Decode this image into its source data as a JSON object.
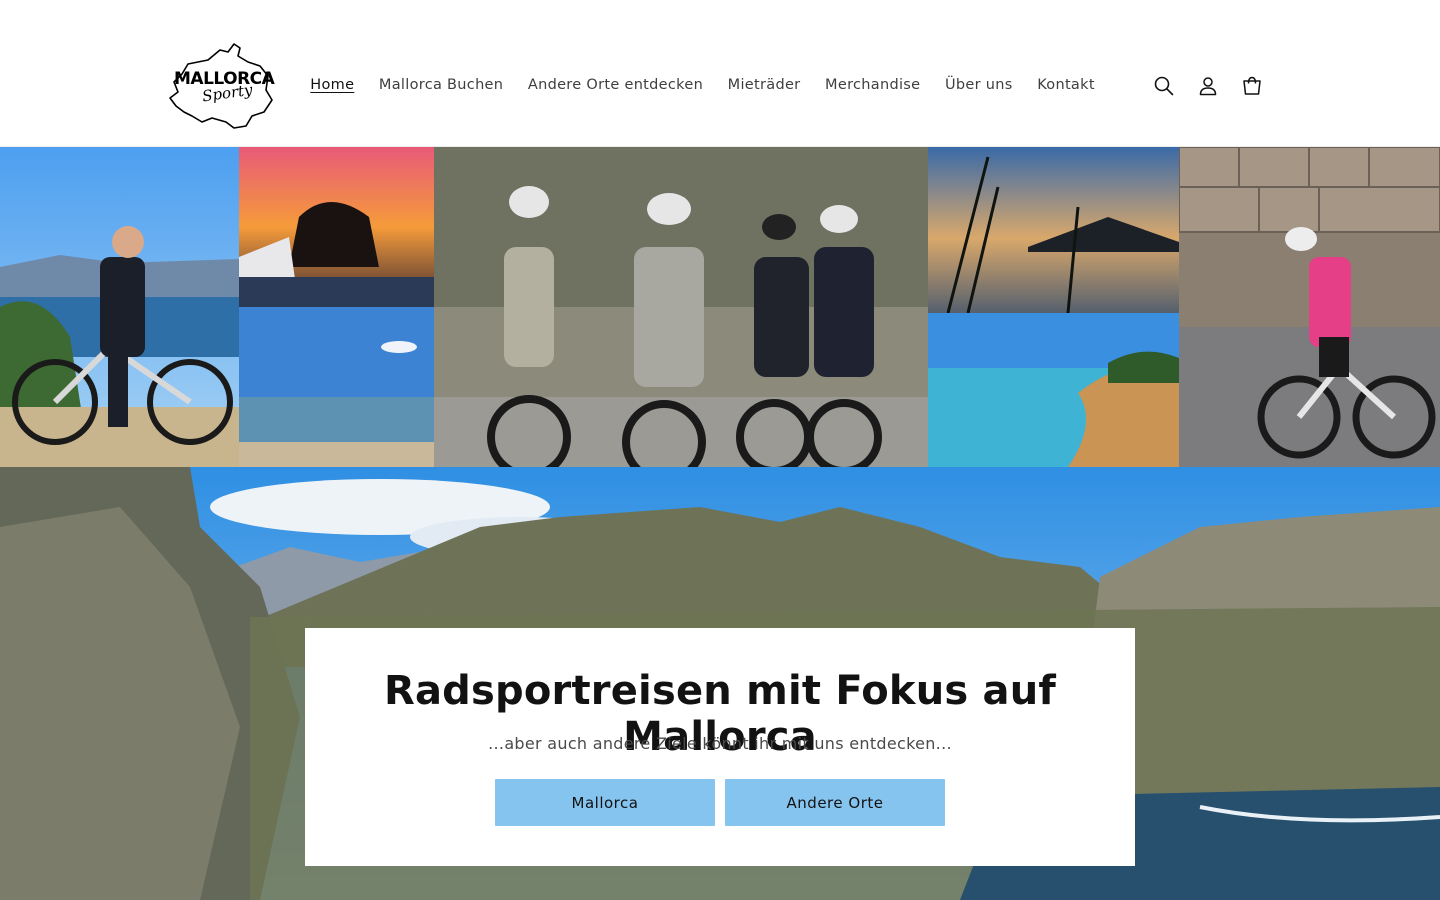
{
  "brand": {
    "logo_text": "MALLORCA",
    "logo_script": "Sporty"
  },
  "nav": {
    "items": [
      {
        "label": "Home",
        "active": true
      },
      {
        "label": "Mallorca Buchen"
      },
      {
        "label": "Andere Orte entdecken"
      },
      {
        "label": "Mieträder"
      },
      {
        "label": "Merchandise"
      },
      {
        "label": "Über uns"
      },
      {
        "label": "Kontakt"
      }
    ]
  },
  "header_icons": [
    "search-icon",
    "account-icon",
    "cart-icon"
  ],
  "hero": {
    "title": "Radsportreisen mit Fokus auf Mallorca",
    "subtitle": "...aber auch andere Ziele könnt ihr mit uns entdecken...",
    "buttons": [
      {
        "label": "Mallorca"
      },
      {
        "label": "Andere Orte"
      }
    ]
  },
  "colors": {
    "button": "#86c4f0",
    "text": "#121212",
    "nav_text": "#3f3f3f"
  }
}
